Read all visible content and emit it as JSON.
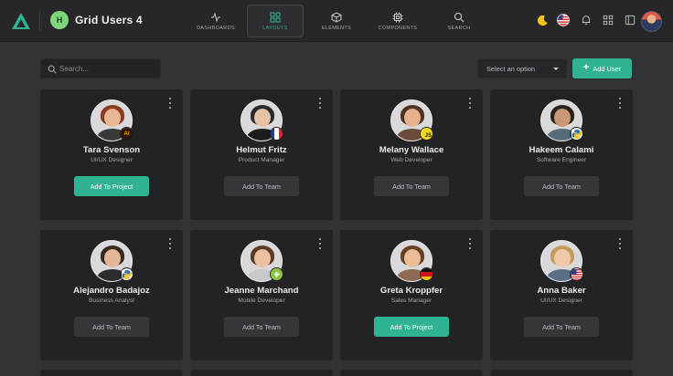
{
  "app": {
    "badge": "H",
    "title": "Grid Users 4"
  },
  "nav": [
    {
      "label": "DASHBOARDS",
      "icon": "activity-icon",
      "active": false
    },
    {
      "label": "LAYOUTS",
      "icon": "grid-icon",
      "active": true
    },
    {
      "label": "ELEMENTS",
      "icon": "cube-icon",
      "active": false
    },
    {
      "label": "COMPONENTS",
      "icon": "chip-icon",
      "active": false
    },
    {
      "label": "SEARCH",
      "icon": "search-icon",
      "active": false
    }
  ],
  "toolbar": {
    "search_placeholder": "Search...",
    "select_value": "Select an option",
    "add_user_label": "Add User"
  },
  "colors": {
    "accent": "#2fb392",
    "background": "#323236",
    "card": "#232326",
    "topbar": "#27272a"
  },
  "users": [
    {
      "name": "Tara Svenson",
      "role": "UI/UX Designer",
      "action": "Add To Project",
      "primary": true,
      "badge": "illustrator",
      "badge_text": "Ai",
      "hair": "#8a3b22",
      "skin": "#e8b894",
      "shirt": "#3a3a3a"
    },
    {
      "name": "Helmut Fritz",
      "role": "Product Manager",
      "action": "Add To Team",
      "primary": false,
      "badge": "flag-france",
      "badge_text": "",
      "hair": "#2a2a2a",
      "skin": "#e7c1a3",
      "shirt": "#1d1d1f"
    },
    {
      "name": "Melany Wallace",
      "role": "Web Developer",
      "action": "Add To Team",
      "primary": false,
      "badge": "javascript",
      "badge_text": "JS",
      "hair": "#4d3322",
      "skin": "#e5b28c",
      "shirt": "#6b4b3a"
    },
    {
      "name": "Hakeem Calami",
      "role": "Software Engineer",
      "action": "Add To Team",
      "primary": false,
      "badge": "python",
      "badge_text": "",
      "hair": "#2b211b",
      "skin": "#c99775",
      "shirt": "#566c7a"
    },
    {
      "name": "Alejandro Badajoz",
      "role": "Business Analyst",
      "action": "Add To Team",
      "primary": false,
      "badge": "python",
      "badge_text": "",
      "hair": "#3a2a1d",
      "skin": "#e3b797",
      "shirt": "#2c2c2e"
    },
    {
      "name": "Jeanne Marchand",
      "role": "Mobile Developer",
      "action": "Add To Team",
      "primary": false,
      "badge": "android",
      "badge_text": "",
      "hair": "#5a3a22",
      "skin": "#edc1a0",
      "shirt": "#c9c9cc"
    },
    {
      "name": "Greta Kroppfer",
      "role": "Sales Manager",
      "action": "Add To Project",
      "primary": true,
      "badge": "flag-germany",
      "badge_text": "",
      "hair": "#6a3f22",
      "skin": "#ebbd9a",
      "shirt": "#8f6a52"
    },
    {
      "name": "Anna Baker",
      "role": "UI/UX Designer",
      "action": "Add To Team",
      "primary": false,
      "badge": "flag-usa",
      "badge_text": "",
      "hair": "#c49a5f",
      "skin": "#f0c9a8",
      "shirt": "#5a6f86"
    }
  ]
}
